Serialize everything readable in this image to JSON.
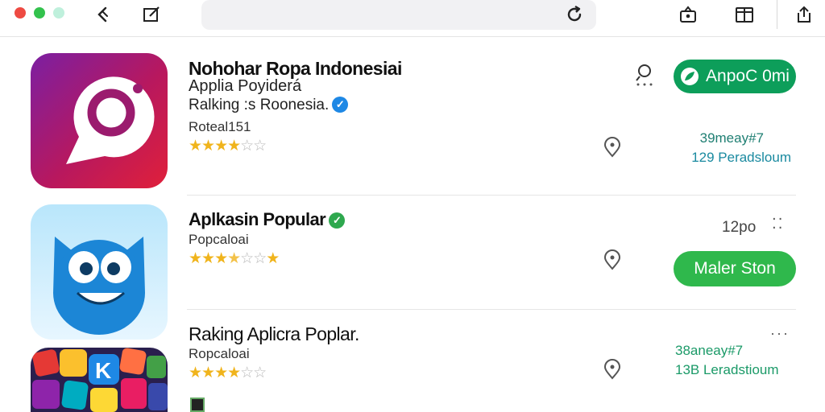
{
  "browser": {
    "traffic_lights": [
      "#ee4a42",
      "#33c24d",
      "#bff0dc"
    ],
    "icons": [
      "back-chevron-icon",
      "compose-icon",
      "reload-icon",
      "share-bag-icon",
      "tabs-icon",
      "share-icon"
    ]
  },
  "apps": [
    {
      "name": "Nohohar Ropa Indonesiai",
      "publisher": "Applia Poyiderá",
      "ranking": "Ralking :s Roonesia.",
      "code": "Roteal151",
      "rating": 3.5,
      "button_label": "AnpoC 0mi",
      "meta_line1": "39meay#7",
      "meta_line2": "129 Peradsloum",
      "verified_color": "#1e88e5"
    },
    {
      "name": "Aplkasin Popular",
      "publisher": "Popcaloai",
      "time": "12po",
      "rating": 3.5,
      "button_label": "Maler Ston",
      "verified_color": "#2ea84e"
    },
    {
      "name": "Raking Aplicra Poplar.",
      "publisher": "Ropcaloai",
      "rating": 3.5,
      "meta_line1": "38aneay#7",
      "meta_line2": "13B Leradstioum"
    }
  ],
  "colors": {
    "teal_button": "#0d9e5a",
    "lime_button": "#2fb84c",
    "star": "#f0b41c"
  }
}
